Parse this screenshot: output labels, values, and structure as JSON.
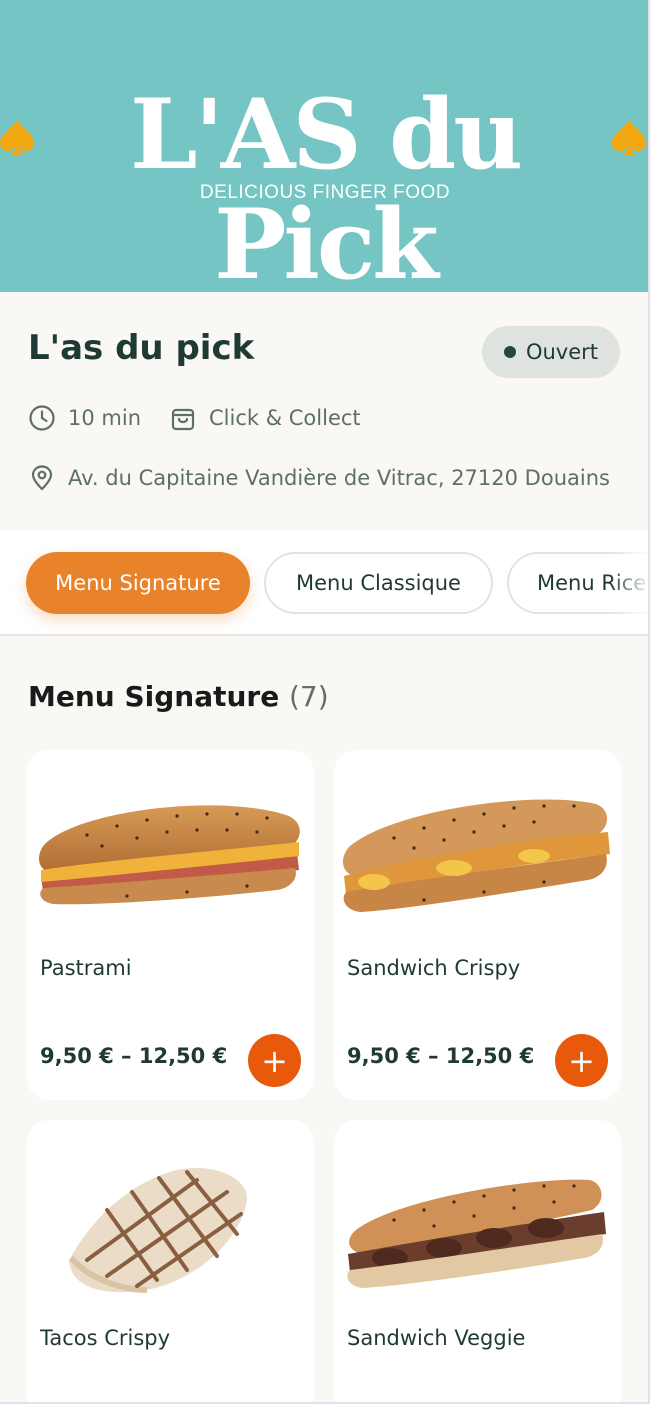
{
  "banner": {
    "logo_text": "L'AS du Pick",
    "logo_tagline": "DELICIOUS FINGER FOOD",
    "background": "#74c5c4"
  },
  "store": {
    "name": "L'as du pick",
    "status": "Ouvert",
    "time": "10 min",
    "mode": "Click & Collect",
    "address": "Av. du Capitaine Vandière de Vitrac, 27120 Douains"
  },
  "tabs": [
    {
      "label": "Menu Signature",
      "active": true
    },
    {
      "label": "Menu Classique",
      "active": false
    },
    {
      "label": "Menu Rice",
      "active": false
    }
  ],
  "section": {
    "title": "Menu Signature",
    "count": "(7)"
  },
  "products": [
    {
      "name": "Pastrami",
      "price": "9,50 € – 12,50 €",
      "add": "+"
    },
    {
      "name": "Sandwich Crispy",
      "price": "9,50 € – 12,50 €",
      "add": "+"
    },
    {
      "name": "Tacos Crispy"
    },
    {
      "name": "Sandwich Veggie"
    }
  ],
  "colors": {
    "accent": "#e8822b",
    "add_button": "#e8590c",
    "text_dark": "#1f3a32"
  },
  "icons": [
    "spade-icon",
    "clock-icon",
    "bag-icon",
    "location-pin-icon",
    "plus-icon"
  ]
}
